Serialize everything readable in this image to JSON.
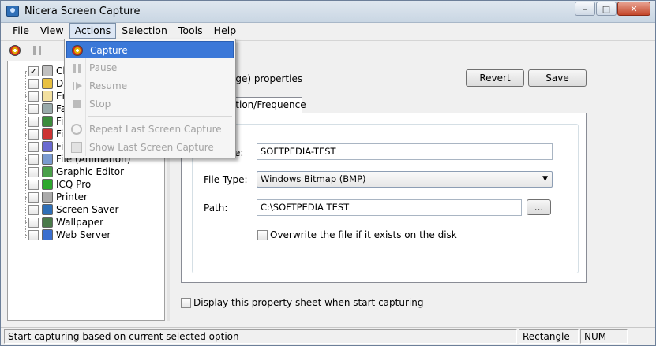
{
  "window": {
    "title": "Nicera Screen Capture",
    "controls": {
      "minimize": "–",
      "maximize": "□",
      "close": "✕"
    }
  },
  "menubar": {
    "items": [
      "File",
      "View",
      "Actions",
      "Selection",
      "Tools",
      "Help"
    ],
    "active": "Actions"
  },
  "actions_menu": {
    "items": [
      {
        "label": "Capture",
        "icon": "capture-icon",
        "state": "highlighted"
      },
      {
        "label": "Pause",
        "icon": "pause-icon",
        "state": "disabled"
      },
      {
        "label": "Resume",
        "icon": "resume-icon",
        "state": "disabled"
      },
      {
        "label": "Stop",
        "icon": "stop-icon",
        "state": "disabled"
      },
      {
        "label": "Repeat Last Screen Capture",
        "icon": "repeat-icon",
        "state": "disabled"
      },
      {
        "label": "Show Last Screen Capture",
        "icon": "show-capture-icon",
        "state": "disabled"
      }
    ]
  },
  "tree": {
    "items": [
      {
        "label": "Cli",
        "checked": true,
        "icon_color": "#c0c0c0"
      },
      {
        "label": "Da",
        "checked": false,
        "icon_color": "#e8c040"
      },
      {
        "label": "Em",
        "checked": false,
        "icon_color": "#f2e0a0"
      },
      {
        "label": "Fa",
        "checked": false,
        "icon_color": "#9aa"
      },
      {
        "label": "File",
        "checked": false,
        "icon_color": "#3c8c3c"
      },
      {
        "label": "File",
        "checked": false,
        "icon_color": "#c33"
      },
      {
        "label": "File",
        "checked": false,
        "icon_color": "#6a6ad0"
      },
      {
        "label": "File (Animation)",
        "checked": false,
        "icon_color": "#7a9ad0"
      },
      {
        "label": "Graphic Editor",
        "checked": false,
        "icon_color": "#4aa04a"
      },
      {
        "label": "ICQ Pro",
        "checked": false,
        "icon_color": "#2ea82e"
      },
      {
        "label": "Printer",
        "checked": false,
        "icon_color": "#aaa"
      },
      {
        "label": "Screen Saver",
        "checked": false,
        "icon_color": "#2f6fb7"
      },
      {
        "label": "Wallpaper",
        "checked": false,
        "icon_color": "#4a7a4a"
      },
      {
        "label": "Web Server",
        "checked": false,
        "icon_color": "#3b6fcf"
      }
    ]
  },
  "properties": {
    "title": "age) properties",
    "revert_label": "Revert",
    "save_label": "Save",
    "tab_label": "ration/Frequence",
    "name_label": "e:",
    "name_value": "SOFTPEDIA-TEST",
    "filetype_label": "File Type:",
    "filetype_value": "Windows Bitmap (BMP)",
    "path_label": "Path:",
    "path_value": "C:\\SOFTPEDIA TEST",
    "browse_label": "...",
    "overwrite_label": "Overwrite the file if it exists on the disk",
    "overwrite_checked": false,
    "display_sheet_label": "Display this property sheet when start capturing",
    "display_sheet_checked": false
  },
  "statusbar": {
    "message": "Start capturing based on current selected option",
    "mode": "Rectangle",
    "num": "NUM"
  }
}
